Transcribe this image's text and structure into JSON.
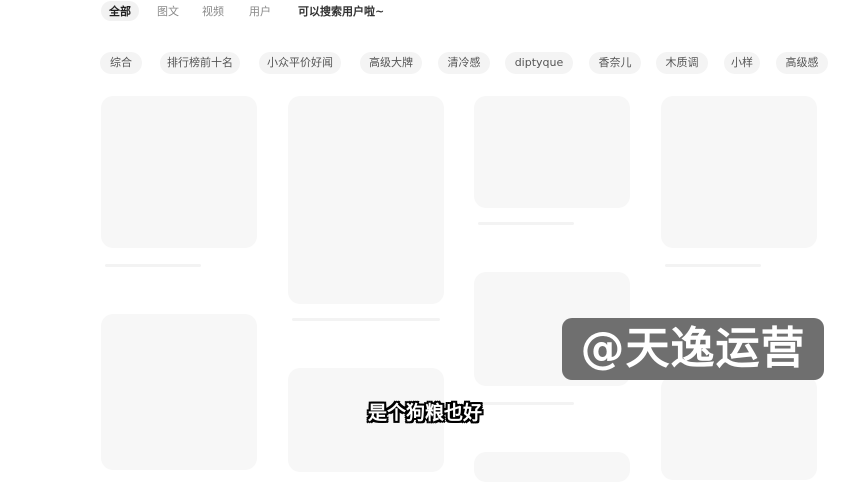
{
  "tabs": [
    {
      "label": "全部",
      "active": true
    },
    {
      "label": "图文"
    },
    {
      "label": "视频"
    },
    {
      "label": "用户"
    }
  ],
  "search_hint": "可以搜索用户啦~",
  "chips": [
    "综合",
    "排行榜前十名",
    "小众平价好闻",
    "高级大牌",
    "清冷感",
    "diptyque",
    "香奈儿",
    "木质调",
    "小样",
    "高级感"
  ],
  "watermark": "@天逸运营",
  "subtitle": "是个狗粮也好",
  "colors": {
    "card_placeholder": "#f7f7f7",
    "chip_bg": "#f4f4f4",
    "active_tab_bg": "#f2f2f2"
  }
}
